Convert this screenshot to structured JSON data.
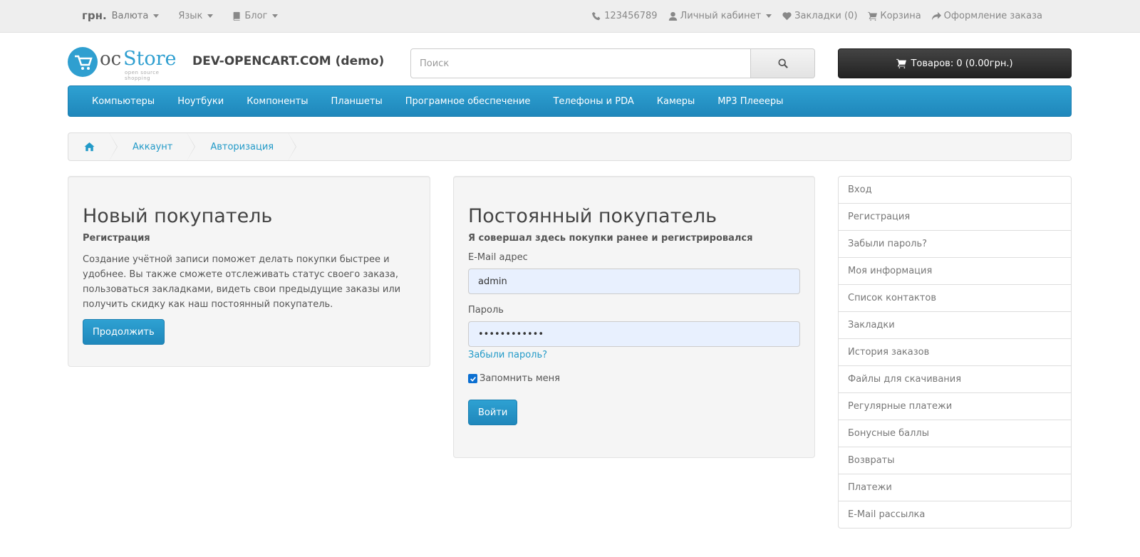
{
  "topbar": {
    "currency_symbol": "грн.",
    "currency_label": "Валюта",
    "language_label": "Язык",
    "blog_label": "Блог",
    "phone": "123456789",
    "account_label": "Личный кабинет",
    "wishlist_label": "Закладки (0)",
    "cart_label": "Корзина",
    "checkout_label": "Оформление заказа"
  },
  "header": {
    "logo_oc": "oc",
    "logo_store": "Store",
    "logo_tagline": "open source shopping",
    "site_name": "DEV-OPENCART.COM (demo)",
    "search_placeholder": "Поиск",
    "cart_button": "Товаров: 0 (0.00грн.)"
  },
  "nav": {
    "items": [
      "Компьютеры",
      "Ноутбуки",
      "Компоненты",
      "Планшеты",
      "Програмное обеспечение",
      "Телефоны и PDA",
      "Камеры",
      "MP3 Плеееры"
    ]
  },
  "breadcrumb": {
    "items": [
      "Аккаунт",
      "Авторизация"
    ]
  },
  "new_customer": {
    "title": "Новый покупатель",
    "subtitle": "Регистрация",
    "description": "Создание учётной записи поможет делать покупки быстрее и удобнее. Вы также сможете отслеживать статус своего заказа, пользоваться закладками, видеть свои предыдущие заказы или получить скидку как наш постоянный покупатель.",
    "button": "Продолжить"
  },
  "returning_customer": {
    "title": "Постоянный покупатель",
    "subtitle": "Я совершал здесь покупки ранее и регистрировался",
    "email_label": "E-Mail адрес",
    "email_value": "admin",
    "password_label": "Пароль",
    "password_value": "••••••••••••",
    "forgot_link": "Забыли пароль?",
    "remember_label": "Запомнить меня",
    "remember_checked": true,
    "login_button": "Войти"
  },
  "account_menu": {
    "items": [
      "Вход",
      "Регистрация",
      "Забыли пароль?",
      "Моя информация",
      "Список контактов",
      "Закладки",
      "История заказов",
      "Файлы для скачивания",
      "Регулярные платежи",
      "Бонусные баллы",
      "Возвраты",
      "Платежи",
      "E-Mail рассылка"
    ]
  },
  "colors": {
    "accent": "#229ac8",
    "nav_bg": "#229ac8",
    "cart_bg": "#303030"
  }
}
